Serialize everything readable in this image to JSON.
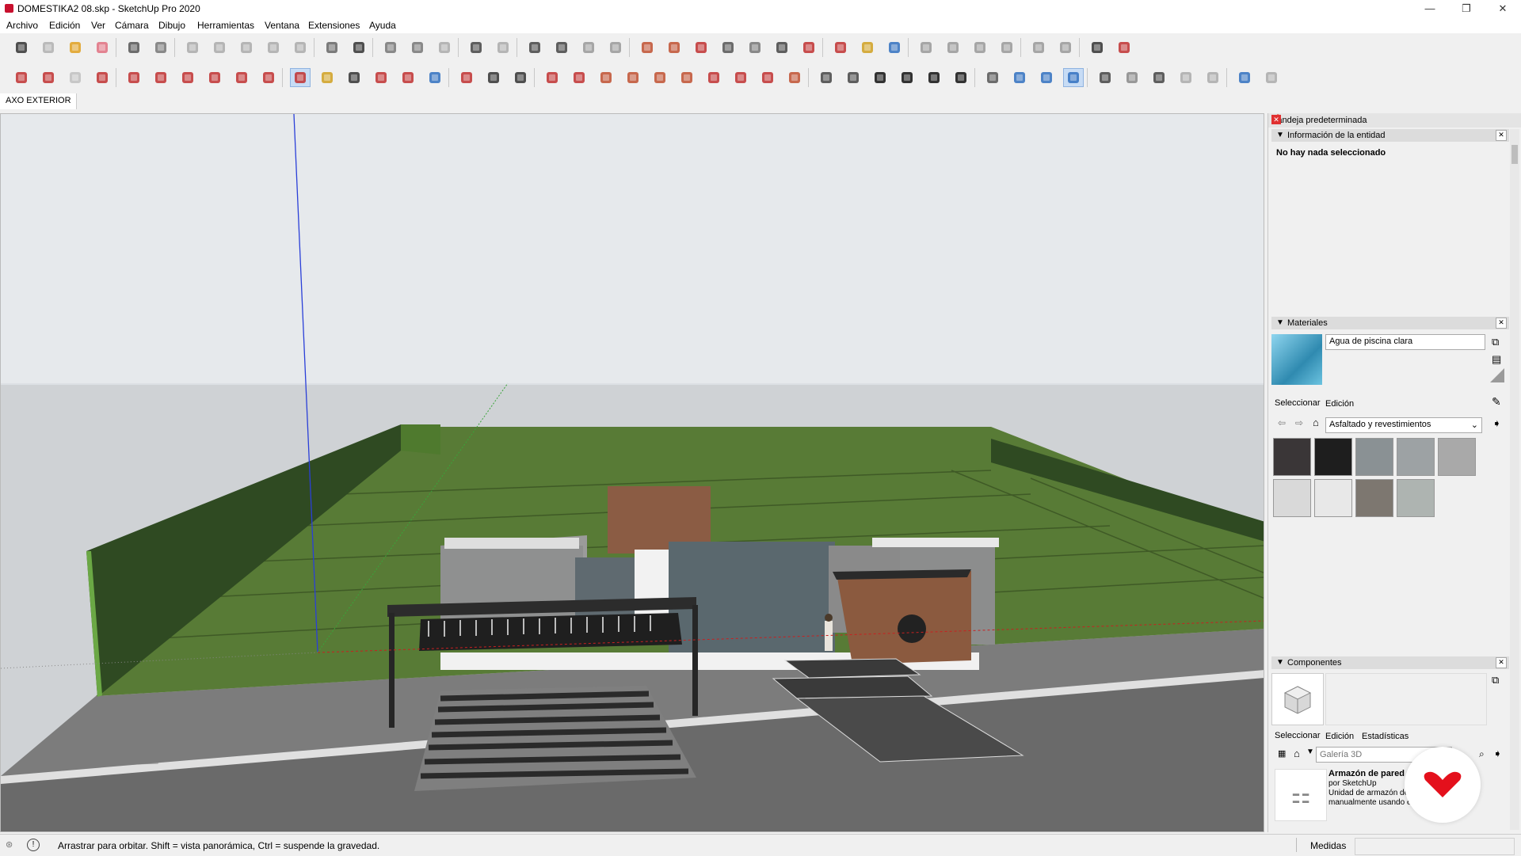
{
  "window": {
    "title": "DOMESTIKA2 08.skp - SketchUp Pro 2020",
    "minimize_glyph": "—",
    "restore_glyph": "❐",
    "close_glyph": "✕"
  },
  "menu": [
    "Archivo",
    "Edición",
    "Ver",
    "Cámara",
    "Dibujo",
    "Herramientas",
    "Ventana",
    "Extensiones",
    "Ayuda"
  ],
  "toolbar_row1": [
    {
      "icon": "select-icon",
      "color": "#333333"
    },
    {
      "icon": "make-component-icon",
      "color": "#b0b0b0"
    },
    {
      "icon": "paint-bucket-icon",
      "color": "#e0a020"
    },
    {
      "icon": "eraser-icon",
      "color": "#e07080"
    },
    {
      "icon": "tape-measure-icon",
      "color": "#555555"
    },
    {
      "icon": "dimension-icon",
      "color": "#777777"
    },
    {
      "icon": "iso-view-icon",
      "color": "#aaaaaa"
    },
    {
      "icon": "top-view-icon",
      "color": "#aaaaaa"
    },
    {
      "icon": "front-view-icon",
      "color": "#aaaaaa"
    },
    {
      "icon": "right-view-icon",
      "color": "#aaaaaa"
    },
    {
      "icon": "back-view-icon",
      "color": "#aaaaaa"
    },
    {
      "icon": "section-plane-icon",
      "color": "#666666"
    },
    {
      "icon": "check-icon",
      "color": "#333333"
    },
    {
      "icon": "sandbox-icon",
      "color": "#777777"
    },
    {
      "icon": "stamp-icon",
      "color": "#777777"
    },
    {
      "icon": "cloud-icon",
      "color": "#aaaaaa"
    },
    {
      "icon": "text-icon",
      "color": "#444444"
    },
    {
      "icon": "3d-text-icon",
      "color": "#aaaaaa"
    },
    {
      "icon": "window-icon",
      "color": "#444444"
    },
    {
      "icon": "camera-icon",
      "color": "#444444"
    },
    {
      "icon": "photo-match-icon",
      "color": "#999999"
    },
    {
      "icon": "lock-icon",
      "color": "#999999"
    },
    {
      "icon": "warehouse-icon",
      "color": "#c05030"
    },
    {
      "icon": "grid-icon",
      "color": "#c05030"
    },
    {
      "icon": "geo-location-icon",
      "color": "#c03030"
    },
    {
      "icon": "terrain-icon",
      "color": "#555555"
    },
    {
      "icon": "hand-icon",
      "color": "#777777"
    },
    {
      "icon": "image-icon",
      "color": "#444444"
    },
    {
      "icon": "flag-icon",
      "color": "#c03030"
    },
    {
      "icon": "extension-warehouse-icon",
      "color": "#c03030"
    },
    {
      "icon": "open-icon",
      "color": "#d0a020"
    },
    {
      "icon": "save-icon",
      "color": "#3070c0"
    },
    {
      "icon": "cut-icon",
      "color": "#999999"
    },
    {
      "icon": "copy-icon",
      "color": "#999999"
    },
    {
      "icon": "paste-icon",
      "color": "#999999"
    },
    {
      "icon": "delete-icon",
      "color": "#999999"
    },
    {
      "icon": "undo-icon",
      "color": "#999999"
    },
    {
      "icon": "redo-icon",
      "color": "#999999"
    },
    {
      "icon": "print-icon",
      "color": "#333333"
    },
    {
      "icon": "model-info-icon",
      "color": "#c03030"
    }
  ],
  "toolbar_row2": [
    {
      "icon": "outliner-icon",
      "color": "#c03030"
    },
    {
      "icon": "layers-icon",
      "color": "#c03030"
    },
    {
      "icon": "styles-icon",
      "color": "#c0c0c0"
    },
    {
      "icon": "materials-icon",
      "color": "#c03030"
    },
    {
      "icon": "move-icon",
      "color": "#c03030"
    },
    {
      "icon": "push-pull-icon",
      "color": "#c03030"
    },
    {
      "icon": "rotate-icon",
      "color": "#c03030"
    },
    {
      "icon": "follow-me-icon",
      "color": "#c03030"
    },
    {
      "icon": "scale-icon",
      "color": "#c03030"
    },
    {
      "icon": "offset-icon",
      "color": "#c03030"
    },
    {
      "icon": "orbit-icon",
      "color": "#c03030",
      "active": true
    },
    {
      "icon": "pan-icon",
      "color": "#d0a020"
    },
    {
      "icon": "zoom-icon",
      "color": "#333333"
    },
    {
      "icon": "zoom-window-icon",
      "color": "#c03030"
    },
    {
      "icon": "zoom-extents-icon",
      "color": "#c03030"
    },
    {
      "icon": "previous-view-icon",
      "color": "#3070c0"
    },
    {
      "icon": "position-camera-icon",
      "color": "#c03030"
    },
    {
      "icon": "look-around-icon",
      "color": "#333333"
    },
    {
      "icon": "walk-icon",
      "color": "#333333"
    },
    {
      "icon": "line-icon",
      "color": "#c03030"
    },
    {
      "icon": "freehand-icon",
      "color": "#c03030"
    },
    {
      "icon": "rectangle-icon",
      "color": "#c05030"
    },
    {
      "icon": "rotated-rectangle-icon",
      "color": "#c05030"
    },
    {
      "icon": "circle-icon",
      "color": "#c05030"
    },
    {
      "icon": "polygon-icon",
      "color": "#c05030"
    },
    {
      "icon": "arc-icon",
      "color": "#c03030"
    },
    {
      "icon": "two-point-arc-icon",
      "color": "#c03030"
    },
    {
      "icon": "three-point-arc-icon",
      "color": "#c03030"
    },
    {
      "icon": "pie-icon",
      "color": "#c05030"
    },
    {
      "icon": "iso-house-icon",
      "color": "#444444"
    },
    {
      "icon": "top-house-icon",
      "color": "#444444"
    },
    {
      "icon": "front-house-icon",
      "color": "#111111"
    },
    {
      "icon": "right-house-icon",
      "color": "#111111"
    },
    {
      "icon": "back-house-icon",
      "color": "#111111"
    },
    {
      "icon": "left-house-icon",
      "color": "#111111"
    },
    {
      "icon": "xray-icon",
      "color": "#555555"
    },
    {
      "icon": "back-edges-icon",
      "color": "#3070c0"
    },
    {
      "icon": "wireframe-icon",
      "color": "#3070c0"
    },
    {
      "icon": "shaded-textures-icon",
      "color": "#3070c0",
      "active": true
    },
    {
      "icon": "section-fill-icon",
      "color": "#444444"
    },
    {
      "icon": "hidden-line-icon",
      "color": "#888888"
    },
    {
      "icon": "shaded-icon",
      "color": "#444444"
    },
    {
      "icon": "sandbox-smoove-icon",
      "color": "#aaaaaa"
    },
    {
      "icon": "sandbox-flip-icon",
      "color": "#aaaaaa"
    },
    {
      "icon": "component-browser-icon",
      "color": "#3070c0"
    },
    {
      "icon": "send-to-layout-icon",
      "color": "#aaaaaa"
    }
  ],
  "scene_tab": "AXO EXTERIOR",
  "tray": {
    "title": "Bandeja predeterminada",
    "entity_panel": {
      "title": "Información de la entidad",
      "message": "No hay nada seleccionado"
    },
    "materials_panel": {
      "title": "Materiales",
      "material_name": "Agua de piscina clara",
      "tab_select": "Seleccionar",
      "tab_edit": "Edición",
      "library": "Asfaltado y revestimientos",
      "swatches": [
        "#3a3637",
        "#1e1e1e",
        "#8a9194",
        "#9da2a4",
        "#a9a9a9",
        "#d9d9d9",
        "#e8e8e8",
        "#7d7770",
        "#aeb4b1"
      ],
      "preview_color": "#4aa8c8"
    },
    "components_panel": {
      "title": "Componentes",
      "tab_select": "Seleccionar",
      "tab_edit": "Edición",
      "tab_stats": "Estadísticas",
      "search_placeholder": "Galería 3D",
      "result_title": "Armazón de pared",
      "result_author": "por SketchUp",
      "result_desc_1": "Unidad de armazón de p...",
      "result_desc_2": "manualmente usando el cu... diálog..."
    }
  },
  "status": {
    "hint": "Arrastrar para orbitar. Shift = vista panorámica, Ctrl = suspende la gravedad.",
    "measures_label": "Medidas"
  },
  "colors": {
    "accent": "#c8102e",
    "selected_tool": "#c7dcf5",
    "grass": "#5a7a3c",
    "hedge": "#2f4a22"
  }
}
